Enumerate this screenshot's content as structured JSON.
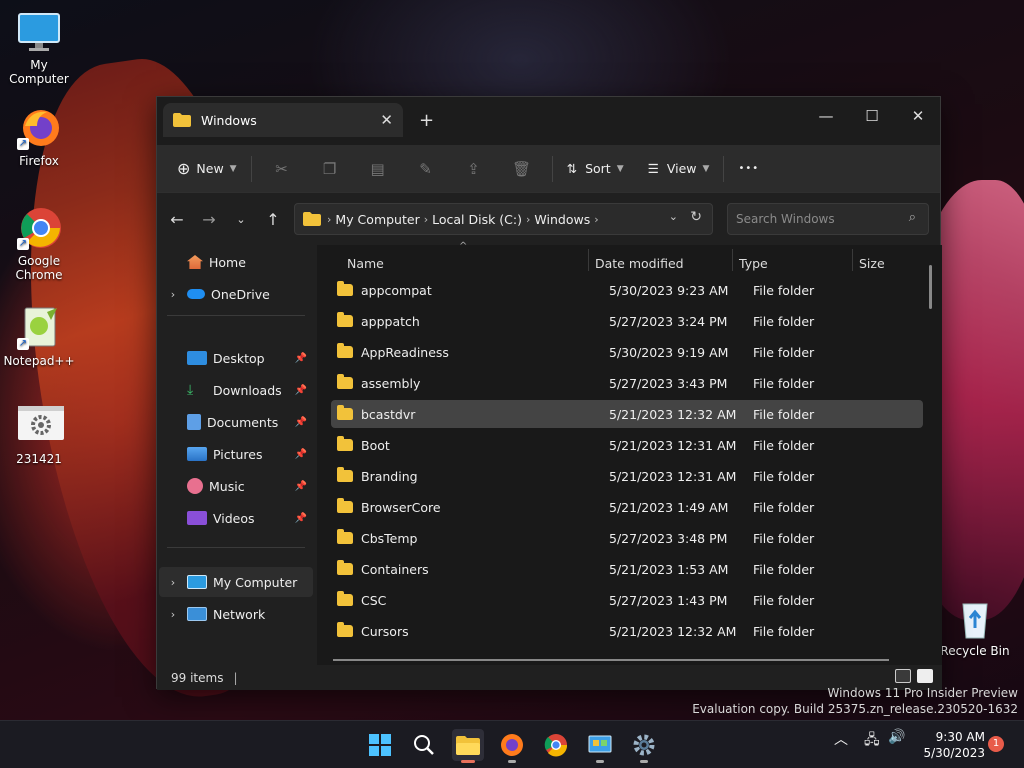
{
  "desktop": {
    "icons": [
      {
        "label": "My Computer",
        "icon": "monitor-icon"
      },
      {
        "label": "Firefox",
        "icon": "firefox-icon"
      },
      {
        "label": "Google Chrome",
        "icon": "chrome-icon"
      },
      {
        "label": "Notepad++",
        "icon": "notepadpp-icon"
      },
      {
        "label": "231421",
        "icon": "settings-file-icon"
      },
      {
        "label": "Recycle Bin",
        "icon": "recycle-bin-icon"
      }
    ]
  },
  "window": {
    "tab_title": "Windows",
    "new_tab_glyph": "+",
    "controls": {
      "minimize": "—",
      "maximize": "☐",
      "close": "✕"
    },
    "toolbar": {
      "new_label": "New",
      "sort_label": "Sort",
      "view_label": "View",
      "more_glyph": "•••"
    },
    "address": {
      "crumbs": [
        "My Computer",
        "Local Disk (C:)",
        "Windows"
      ]
    },
    "search": {
      "placeholder": "Search Windows"
    },
    "nav": {
      "home": "Home",
      "onedrive": "OneDrive",
      "pinned": [
        "Desktop",
        "Downloads",
        "Documents",
        "Pictures",
        "Music",
        "Videos"
      ],
      "my_computer": "My Computer",
      "network": "Network"
    },
    "columns": {
      "name": "Name",
      "date": "Date modified",
      "type": "Type",
      "size": "Size"
    },
    "files": [
      {
        "name": "appcompat",
        "date": "5/30/2023 9:23 AM",
        "type": "File folder"
      },
      {
        "name": "apppatch",
        "date": "5/27/2023 3:24 PM",
        "type": "File folder"
      },
      {
        "name": "AppReadiness",
        "date": "5/30/2023 9:19 AM",
        "type": "File folder"
      },
      {
        "name": "assembly",
        "date": "5/27/2023 3:43 PM",
        "type": "File folder"
      },
      {
        "name": "bcastdvr",
        "date": "5/21/2023 12:32 AM",
        "type": "File folder"
      },
      {
        "name": "Boot",
        "date": "5/21/2023 12:31 AM",
        "type": "File folder"
      },
      {
        "name": "Branding",
        "date": "5/21/2023 12:31 AM",
        "type": "File folder"
      },
      {
        "name": "BrowserCore",
        "date": "5/21/2023 1:49 AM",
        "type": "File folder"
      },
      {
        "name": "CbsTemp",
        "date": "5/27/2023 3:48 PM",
        "type": "File folder"
      },
      {
        "name": "Containers",
        "date": "5/21/2023 1:53 AM",
        "type": "File folder"
      },
      {
        "name": "CSC",
        "date": "5/27/2023 1:43 PM",
        "type": "File folder"
      },
      {
        "name": "Cursors",
        "date": "5/21/2023 12:32 AM",
        "type": "File folder"
      }
    ],
    "status": {
      "count": "99 items",
      "sep": "|"
    }
  },
  "watermark": {
    "line1": "Windows 11 Pro Insider Preview",
    "line2": "Evaluation copy. Build 25375.zn_release.230520-1632"
  },
  "taskbar": {
    "clock_time": "9:30 AM",
    "clock_date": "5/30/2023",
    "notification_count": "1"
  },
  "colors": {
    "folder": "#f2c23a",
    "accent": "#4cc2ff",
    "selected_row": "#444444"
  }
}
